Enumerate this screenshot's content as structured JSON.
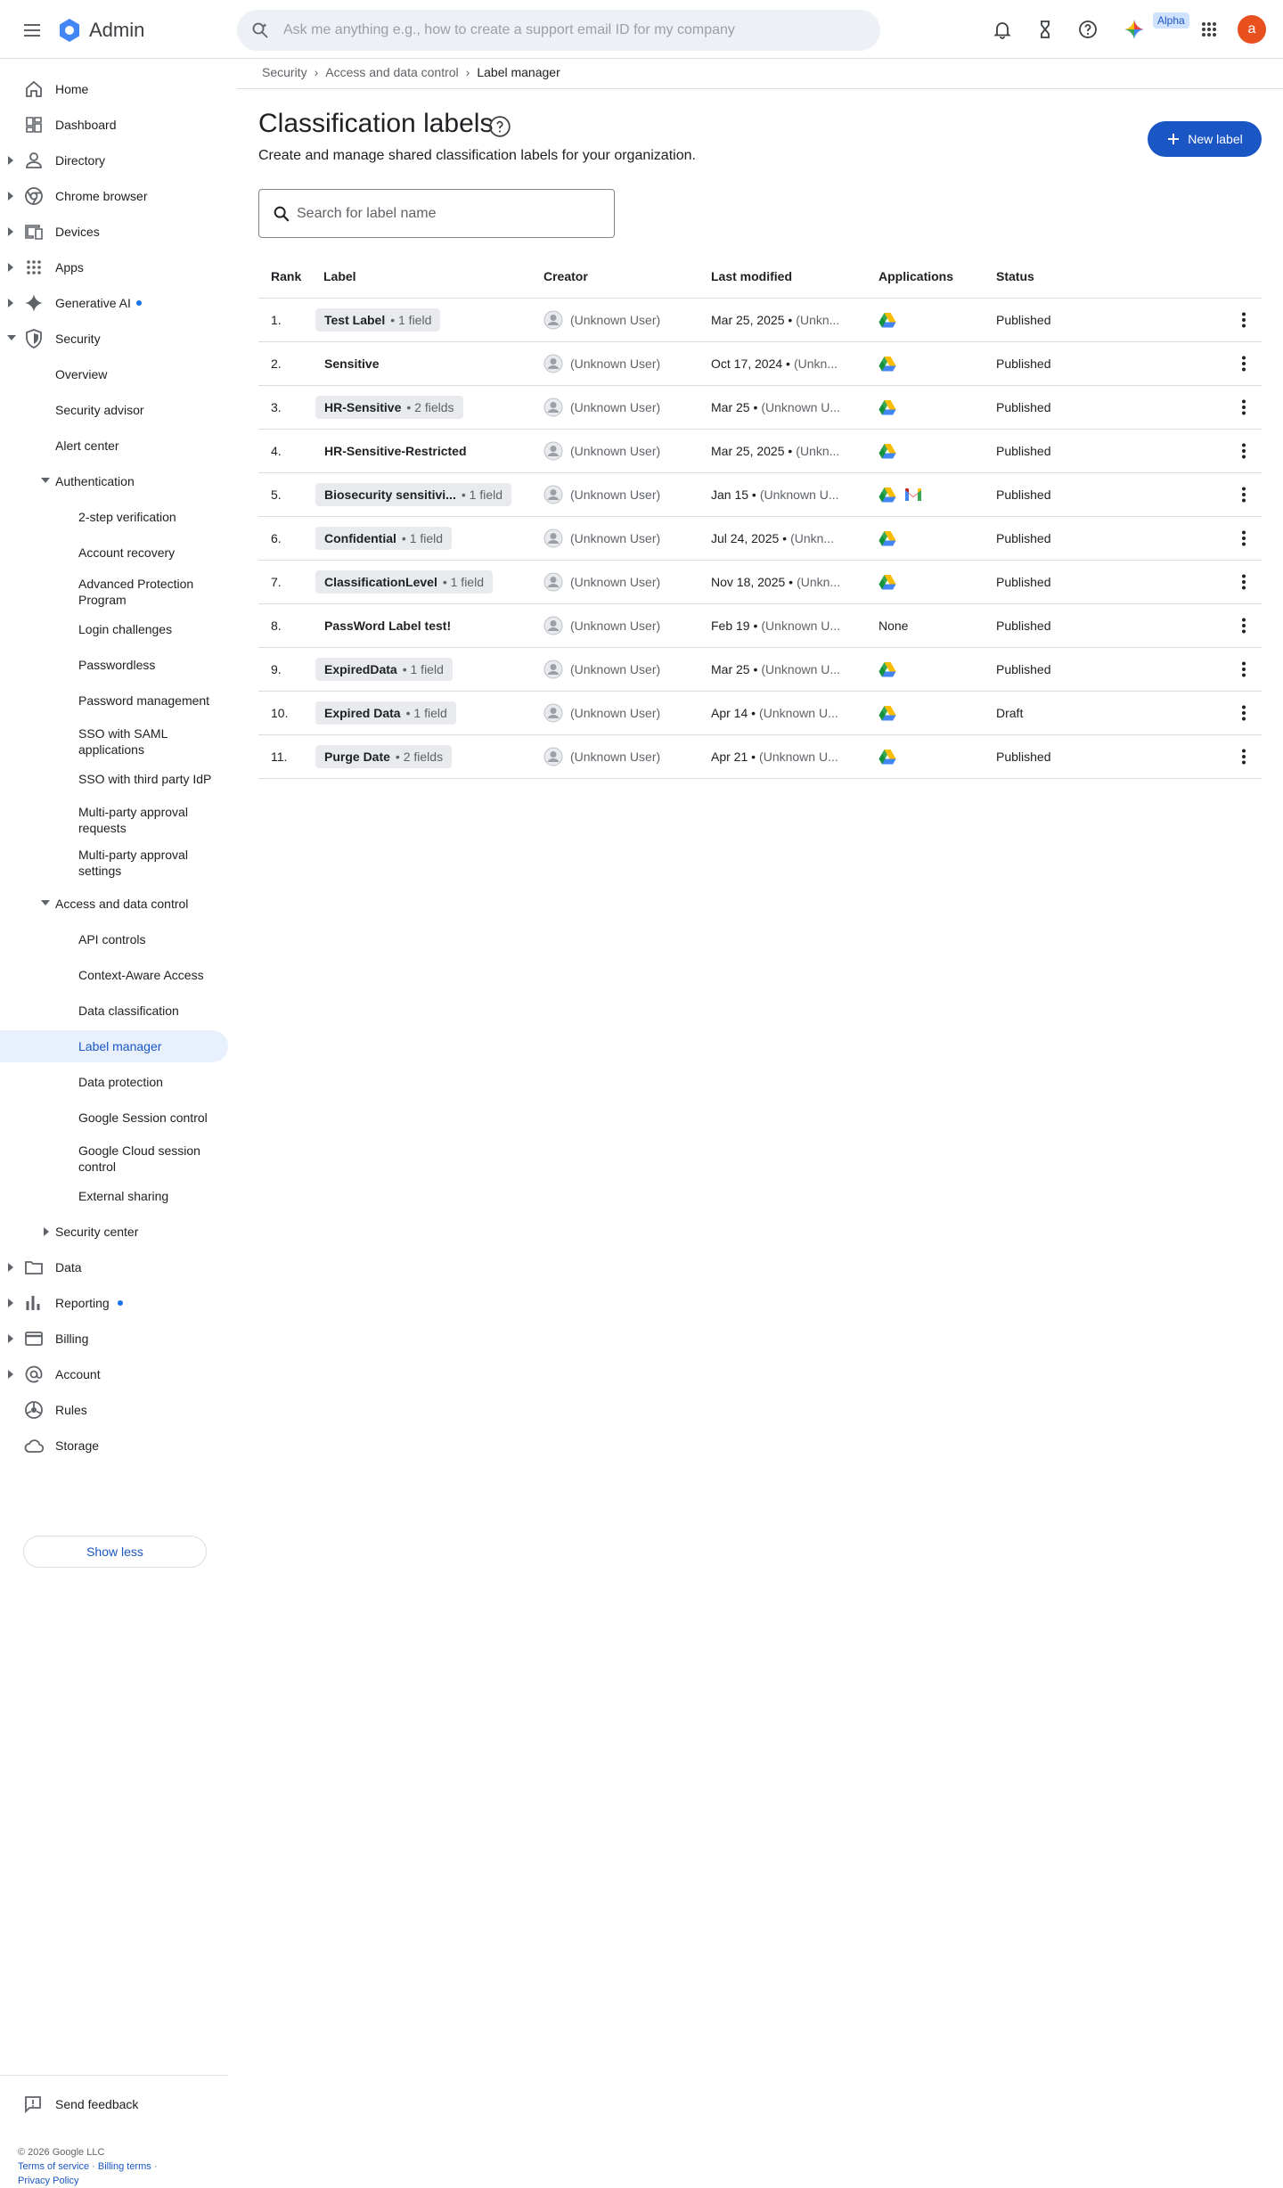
{
  "app": {
    "title": "Admin",
    "search_placeholder": "Ask me anything e.g., how to create a support email ID for my company",
    "alpha_badge": "Alpha",
    "avatar_letter": "a",
    "accent_color": "#1a56c4",
    "avatar_color": "#e8501f"
  },
  "topbar_icons": [
    "menu-icon",
    "admin-logo-icon",
    "search-spark-icon",
    "bell-icon",
    "hourglass-icon",
    "help-icon",
    "gemini-icon",
    "apps-grid-icon"
  ],
  "sidebar": {
    "items": [
      {
        "label": "Home",
        "icon": "home-icon"
      },
      {
        "label": "Dashboard",
        "icon": "dashboard-icon"
      },
      {
        "label": "Directory",
        "icon": "person-icon"
      },
      {
        "label": "Chrome browser",
        "icon": "chrome-icon"
      },
      {
        "label": "Devices",
        "icon": "devices-icon"
      },
      {
        "label": "Apps",
        "icon": "apps-icon"
      },
      {
        "label": "Generative AI",
        "icon": "sparkle-icon"
      },
      {
        "label": "Security",
        "icon": "shield-icon"
      },
      {
        "label": "Overview"
      },
      {
        "label": "Security advisor"
      },
      {
        "label": "Alert center"
      },
      {
        "label": "Authentication"
      },
      {
        "label": "2-step verification"
      },
      {
        "label": "Account recovery"
      },
      {
        "label": "Advanced Protection Program"
      },
      {
        "label": "Login challenges"
      },
      {
        "label": "Passwordless"
      },
      {
        "label": "Password management"
      },
      {
        "label": "SSO with SAML applications"
      },
      {
        "label": "SSO with third party IdP"
      },
      {
        "label": "Multi-party approval requests"
      },
      {
        "label": "Multi-party approval settings"
      },
      {
        "label": "Access and data control"
      },
      {
        "label": "API controls"
      },
      {
        "label": "Context-Aware Access"
      },
      {
        "label": "Data classification"
      },
      {
        "label": "Label manager"
      },
      {
        "label": "Data protection"
      },
      {
        "label": "Google Session control"
      },
      {
        "label": "Google Cloud session control"
      },
      {
        "label": "External sharing"
      },
      {
        "label": "Security center"
      },
      {
        "label": "Data",
        "icon": "folder-icon"
      },
      {
        "label": "Reporting",
        "icon": "bar-chart-icon"
      },
      {
        "label": "Billing",
        "icon": "credit-card-icon"
      },
      {
        "label": "Account",
        "icon": "at-sign-icon"
      },
      {
        "label": "Rules",
        "icon": "rules-icon"
      },
      {
        "label": "Storage",
        "icon": "cloud-icon"
      }
    ],
    "show_less": "Show less",
    "send_feedback": "Send feedback",
    "copyright": "© 2026 Google LLC",
    "terms": "Terms of service",
    "billing_terms": "Billing terms",
    "privacy": "Privacy Policy"
  },
  "breadcrumb": [
    "Security",
    "Access and data control",
    "Label manager"
  ],
  "page": {
    "title": "Classification labels",
    "subtitle": "Create and manage shared classification labels for your organization.",
    "new_label": "New label",
    "search_placeholder": "Search for label name"
  },
  "table": {
    "columns": [
      "Rank",
      "Label",
      "Creator",
      "Last modified",
      "Applications",
      "Status"
    ],
    "rows": [
      {
        "rank": "1.",
        "label": "Test Label",
        "fields": "1 field",
        "creator": "(Unknown User)",
        "modified": "Mar 25, 2025 •",
        "by": "(Unkn...",
        "apps": [
          "drive"
        ],
        "status": "Published"
      },
      {
        "rank": "2.",
        "label": "Sensitive",
        "fields": "",
        "creator": "(Unknown User)",
        "modified": "Oct 17, 2024 •",
        "by": "(Unkn...",
        "apps": [
          "drive"
        ],
        "status": "Published"
      },
      {
        "rank": "3.",
        "label": "HR-Sensitive",
        "fields": "2 fields",
        "creator": "(Unknown User)",
        "modified": "Mar 25 •",
        "by": "(Unknown U...",
        "apps": [
          "drive"
        ],
        "status": "Published"
      },
      {
        "rank": "4.",
        "label": "HR-Sensitive-Restricted",
        "fields": "",
        "creator": "(Unknown User)",
        "modified": "Mar 25, 2025 •",
        "by": "(Unkn...",
        "apps": [
          "drive"
        ],
        "status": "Published"
      },
      {
        "rank": "5.",
        "label": "Biosecurity sensitivi...",
        "fields": "1 field",
        "creator": "(Unknown User)",
        "modified": "Jan 15 •",
        "by": "(Unknown U...",
        "apps": [
          "drive",
          "gmail"
        ],
        "status": "Published"
      },
      {
        "rank": "6.",
        "label": "Confidential",
        "fields": "1 field",
        "creator": "(Unknown User)",
        "modified": "Jul 24, 2025 •",
        "by": "(Unkn...",
        "apps": [
          "drive"
        ],
        "status": "Published"
      },
      {
        "rank": "7.",
        "label": "ClassificationLevel",
        "fields": "1 field",
        "creator": "(Unknown User)",
        "modified": "Nov 18, 2025 •",
        "by": "(Unkn...",
        "apps": [
          "drive"
        ],
        "status": "Published"
      },
      {
        "rank": "8.",
        "label": "PassWord Label test!",
        "fields": "",
        "creator": "(Unknown User)",
        "modified": "Feb 19 •",
        "by": "(Unknown U...",
        "apps": [],
        "apps_text": "None",
        "status": "Published"
      },
      {
        "rank": "9.",
        "label": "ExpiredData",
        "fields": "1 field",
        "creator": "(Unknown User)",
        "modified": "Mar 25 •",
        "by": "(Unknown U...",
        "apps": [
          "drive"
        ],
        "status": "Published"
      },
      {
        "rank": "10.",
        "label": "Expired Data",
        "fields": "1 field",
        "creator": "(Unknown User)",
        "modified": "Apr 14 •",
        "by": "(Unknown U...",
        "apps": [
          "drive"
        ],
        "status": "Draft"
      },
      {
        "rank": "11.",
        "label": "Purge Date",
        "fields": "2 fields",
        "creator": "(Unknown User)",
        "modified": "Apr 21 •",
        "by": "(Unknown U...",
        "apps": [
          "drive"
        ],
        "status": "Published"
      }
    ]
  }
}
